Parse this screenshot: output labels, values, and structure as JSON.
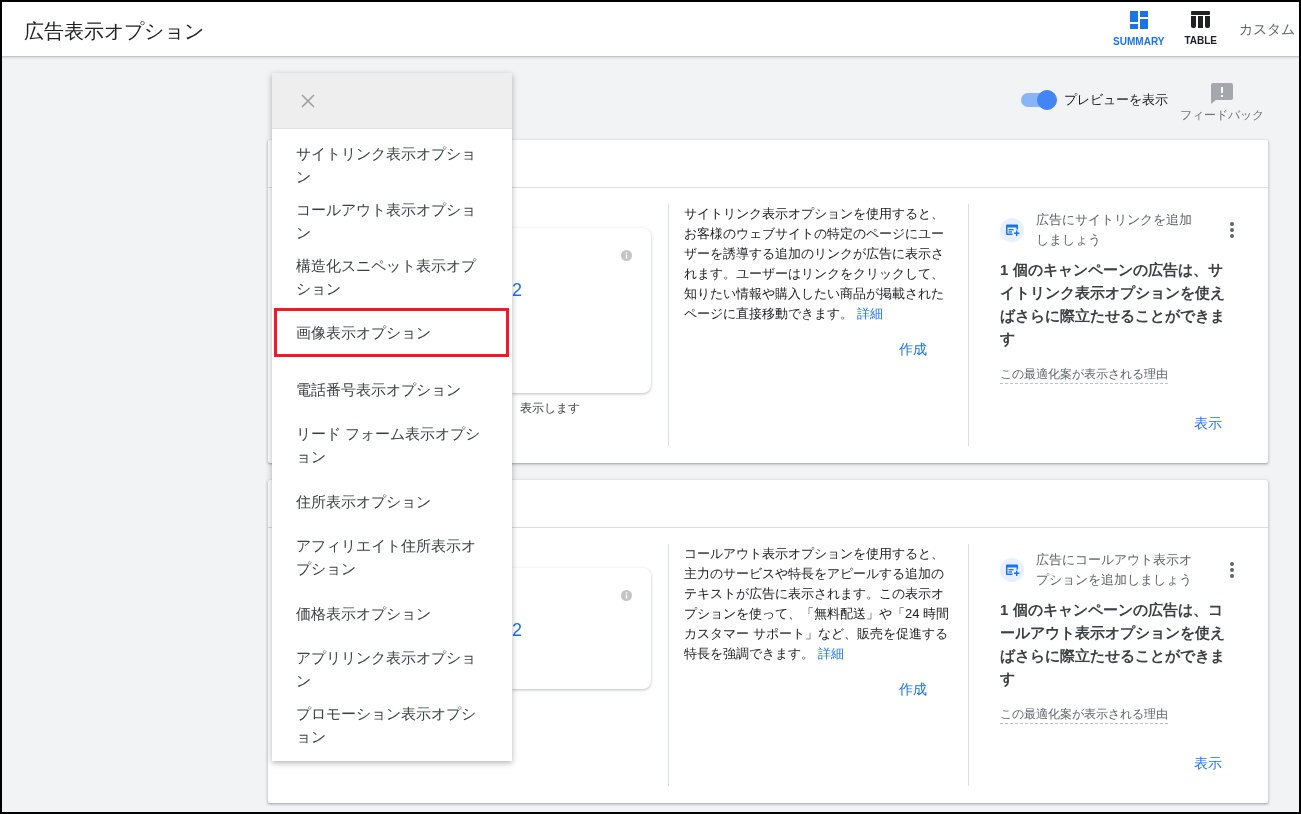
{
  "header": {
    "title": "広告表示オプション",
    "view_tabs": [
      {
        "label": "SUMMARY",
        "kind": "summary",
        "selected": true
      },
      {
        "label": "TABLE",
        "kind": "table",
        "selected": false
      }
    ],
    "custom_label": "カスタム"
  },
  "toolbar": {
    "preview_toggle": {
      "label": "プレビューを表示",
      "on": true
    },
    "feedback": {
      "label": "フィードバック"
    }
  },
  "cards": [
    {
      "kind": "sitelink",
      "preview": {
        "number": "2",
        "caption": "表示します"
      },
      "description": "サイトリンク表示オプションを使用すると、お客様のウェブサイトの特定のページにユーザーを誘導する追加のリンクが広告に表示されます。ユーザーはリンクをクリックして、知りたい情報や購入したい商品が掲載されたページに直接移動できます。",
      "details_link": "詳細",
      "create_button": "作成",
      "suggestion": {
        "title": "広告にサイトリンクを追加しましょう",
        "message": "1 個のキャンペーンの広告は、サイトリンク表示オプションを使えばさらに際立たせることができます",
        "reason": "この最適化案が表示される理由",
        "view_button": "表示"
      }
    },
    {
      "kind": "callout",
      "preview": {
        "number": "2"
      },
      "description": "コールアウト表示オプションを使用すると、主力のサービスや特長をアピールする追加のテキストが広告に表示されます。この表示オプションを使って、「無料配送」や「24 時間カスタマー サポート」など、販売を促進する特長を強調できます。",
      "details_link": "詳細",
      "create_button": "作成",
      "suggestion": {
        "title": "広告にコールアウト表示オプションを追加しましょう",
        "message": "1 個のキャンペーンの広告は、コールアウト表示オプションを使えばさらに際立たせることができます",
        "reason": "この最適化案が表示される理由",
        "view_button": "表示"
      }
    }
  ],
  "menu": {
    "items": [
      {
        "label": "サイトリンク表示オプション",
        "highlighted": false
      },
      {
        "label": "コールアウト表示オプション",
        "highlighted": false
      },
      {
        "label": "構造化スニペット表示オプション",
        "highlighted": false
      },
      {
        "label": "画像表示オプション",
        "highlighted": true
      },
      {
        "label": "電話番号表示オプション",
        "highlighted": false
      },
      {
        "label": "リード フォーム表示オプション",
        "highlighted": false
      },
      {
        "label": "住所表示オプション",
        "highlighted": false
      },
      {
        "label": "アフィリエイト住所表示オプション",
        "highlighted": false
      },
      {
        "label": "価格表示オプション",
        "highlighted": false
      },
      {
        "label": "アプリリンク表示オプション",
        "highlighted": false
      },
      {
        "label": "プロモーション表示オプション",
        "highlighted": false
      }
    ]
  }
}
